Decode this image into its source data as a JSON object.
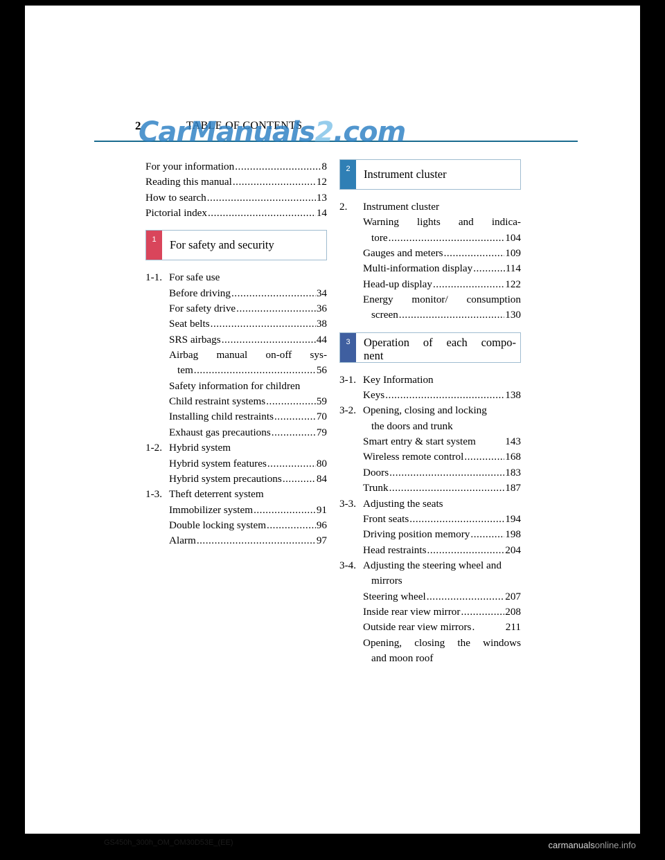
{
  "header": {
    "page_number": "2",
    "title": "TABLE OF CONTENTS",
    "watermark_part1": "CarManuals",
    "watermark_part2": "2",
    "watermark_part3": ".com"
  },
  "footer": {
    "document_code": "GS450h_300h_OM_OM30D53E_(EE)",
    "site_brand_light": "carmanuals",
    "site_brand_dark": "online.info"
  },
  "left_column": {
    "intro_entries": [
      {
        "label": "For your information",
        "page": "8"
      },
      {
        "label": "Reading this manual",
        "page": "12"
      },
      {
        "label": "How to search",
        "page": "13"
      },
      {
        "label": "Pictorial index",
        "page": "14"
      }
    ],
    "banner": {
      "number": "1",
      "title": "For safety and security"
    },
    "sections": [
      {
        "number": "1-1.",
        "title": "For safe use",
        "items": [
          {
            "label": "Before driving",
            "page": "34",
            "style": "dots"
          },
          {
            "label": "For safety drive",
            "page": "36",
            "style": "dots"
          },
          {
            "label": "Seat belts",
            "page": "38",
            "style": "dots"
          },
          {
            "label": "SRS airbags",
            "page": "44",
            "style": "dots"
          },
          {
            "label": "Airbag manual on-off sys-",
            "label2": "tem",
            "page": "56",
            "style": "wrap"
          },
          {
            "label": "Safety information for children",
            "page": "",
            "style": "plain"
          },
          {
            "label": "Child restraint systems",
            "page": "59",
            "style": "dots"
          },
          {
            "label": "Installing child restraints",
            "page": "70",
            "style": "dots"
          },
          {
            "label": "Exhaust gas precautions",
            "page": "79",
            "style": "dots"
          }
        ]
      },
      {
        "number": "1-2.",
        "title": "Hybrid system",
        "items": [
          {
            "label": "Hybrid system features",
            "page": "80",
            "style": "dots"
          },
          {
            "label": "Hybrid system precautions",
            "page": "84",
            "style": "dots"
          }
        ]
      },
      {
        "number": "1-3.",
        "title": "Theft deterrent system",
        "items": [
          {
            "label": "Immobilizer system",
            "page": "91",
            "style": "dots"
          },
          {
            "label": "Double locking system",
            "page": "96",
            "style": "dots"
          },
          {
            "label": "Alarm",
            "page": "97",
            "style": "dots"
          }
        ]
      }
    ]
  },
  "right_column": {
    "banner1": {
      "number": "2",
      "title": "Instrument cluster"
    },
    "section2": {
      "number": "2.",
      "title": "Instrument cluster",
      "items": [
        {
          "label": "Warning lights and indica-",
          "label2": "tore",
          "page": "104",
          "style": "wrap"
        },
        {
          "label": "Gauges and meters",
          "page": "109",
          "style": "dots"
        },
        {
          "label": "Multi-information display",
          "page": "114",
          "style": "dots"
        },
        {
          "label": "Head-up display",
          "page": "122",
          "style": "dots"
        },
        {
          "label": "Energy monitor/ consumption",
          "label2": "screen",
          "page": "130",
          "style": "wrap"
        }
      ]
    },
    "banner2": {
      "number": "3",
      "title_line1": "Operation of each compo-",
      "title_line2": "nent"
    },
    "sections": [
      {
        "number": "3-1.",
        "title": "Key Information",
        "items": [
          {
            "label": "Keys",
            "page": "138",
            "style": "dots"
          }
        ]
      },
      {
        "number": "3-2.",
        "title": "Opening, closing and locking",
        "title2": "the doors and trunk",
        "items": [
          {
            "label": "Smart entry & start system",
            "page": "143",
            "style": "plainpage"
          },
          {
            "label": "Wireless remote control",
            "page": "168",
            "style": "dots"
          },
          {
            "label": "Doors",
            "page": "183",
            "style": "dots"
          },
          {
            "label": "Trunk",
            "page": "187",
            "style": "dots"
          }
        ]
      },
      {
        "number": "3-3.",
        "title": "Adjusting the seats",
        "items": [
          {
            "label": "Front seats",
            "page": "194",
            "style": "dots"
          },
          {
            "label": "Driving position memory",
            "page": "198",
            "style": "dots"
          },
          {
            "label": "Head restraints",
            "page": "204",
            "style": "dots"
          }
        ]
      },
      {
        "number": "3-4.",
        "title": "Adjusting the steering wheel and",
        "title2": "mirrors",
        "items": [
          {
            "label": "Steering wheel",
            "page": "207",
            "style": "dots"
          },
          {
            "label": "Inside rear view mirror",
            "page": "208",
            "style": "dots"
          },
          {
            "label": "Outside rear view mirrors",
            "page": "211",
            "style": "dots"
          },
          {
            "label": "Opening, closing the windows",
            "label2": "and moon roof",
            "page": "",
            "style": "wrapnopage"
          }
        ]
      }
    ]
  },
  "colors": {
    "rule": "#1a6b8f",
    "banner_red": "#d9455b",
    "banner_blue": "#2f7fb5",
    "banner_navy": "#3f5fa0",
    "watermark_blue": "#2b7fc4"
  }
}
